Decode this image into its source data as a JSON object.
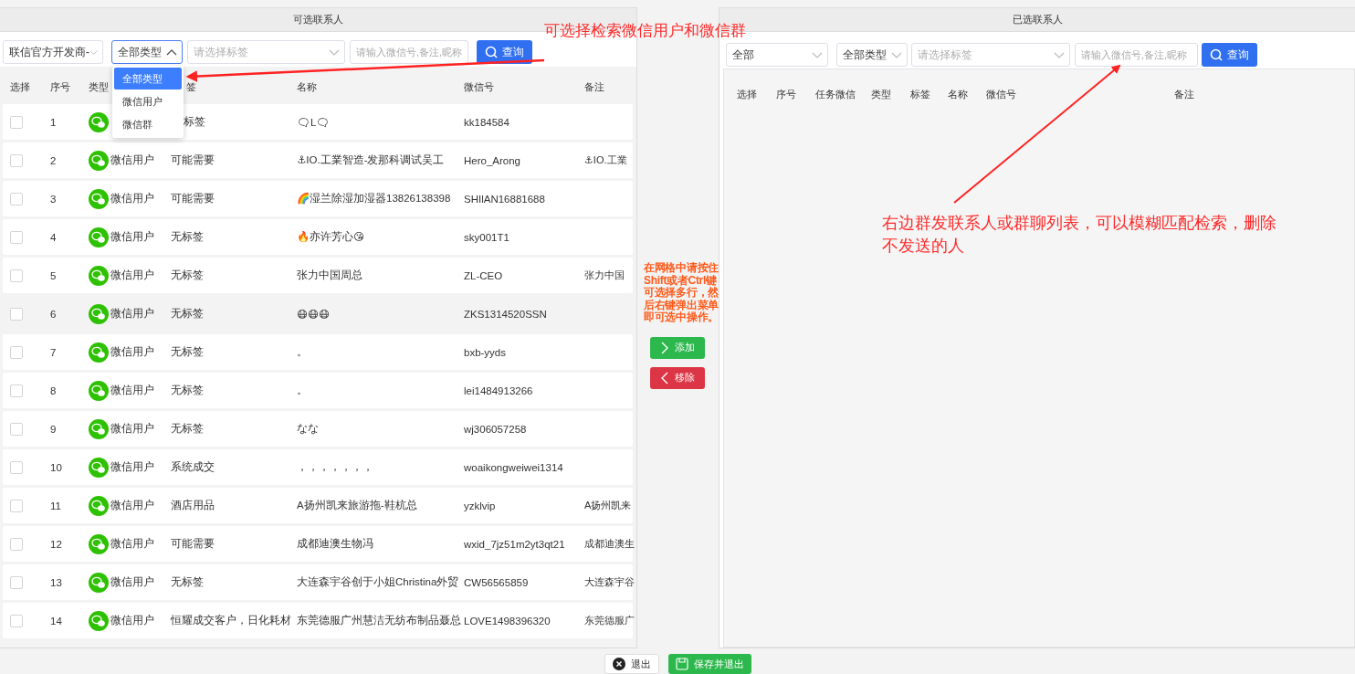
{
  "left_panel": {
    "title": "可选联系人",
    "filters": [
      {
        "kind": "select",
        "value": "联信官方开发商-",
        "open": false
      },
      {
        "kind": "select",
        "value": "全部类型",
        "open": true,
        "options": [
          {
            "label": "全部类型",
            "selected": true
          },
          {
            "label": "微信用户",
            "selected": false
          },
          {
            "label": "微信群",
            "selected": false
          }
        ]
      },
      {
        "kind": "select",
        "placeholder": "请选择标签",
        "open": false
      },
      {
        "kind": "input",
        "placeholder": "请输入微信号,备注,昵称"
      }
    ],
    "search_button": "查询",
    "columns": [
      "选择",
      "序号",
      "类型",
      "签",
      "名称",
      "微信号",
      "备注"
    ],
    "rows": [
      {
        "index": "1",
        "tag": "标签",
        "name": "🗨L🗨",
        "wechat_id": "kk184584",
        "checked": false,
        "highlighted": false
      },
      {
        "index": "2",
        "type": "微信用户",
        "tag": "可能需要",
        "name": "⚓IO.工業智造-发那科调试吴工",
        "wechat_id": "Hero_Arong",
        "remark": "⚓IO.工業",
        "checked": false,
        "highlighted": false
      },
      {
        "index": "3",
        "type": "微信用户",
        "tag": "可能需要",
        "name": "🌈湿兰除湿加湿器13826138398",
        "wechat_id": "SHIlAN16881688",
        "checked": false,
        "highlighted": false
      },
      {
        "index": "4",
        "type": "微信用户",
        "tag": "无标签",
        "name": "🔥亦许芳心😘",
        "wechat_id": "sky001T1",
        "checked": false,
        "highlighted": false
      },
      {
        "index": "5",
        "type": "微信用户",
        "tag": "无标签",
        "name": "张力中国周总",
        "wechat_id": "ZL-CEO",
        "remark": "张力中国",
        "checked": false,
        "highlighted": false
      },
      {
        "index": "6",
        "type": "微信用户",
        "tag": "无标签",
        "name": "😷😷😷",
        "wechat_id": "ZKS1314520SSN",
        "checked": false,
        "highlighted": true
      },
      {
        "index": "7",
        "type": "微信用户",
        "tag": "无标签",
        "name": "。",
        "wechat_id": "bxb-yyds",
        "checked": false,
        "highlighted": false
      },
      {
        "index": "8",
        "type": "微信用户",
        "tag": "无标签",
        "name": "。",
        "wechat_id": "lei1484913266",
        "checked": false,
        "highlighted": false
      },
      {
        "index": "9",
        "type": "微信用户",
        "tag": "无标签",
        "name": "なな",
        "wechat_id": "wj306057258",
        "checked": false,
        "highlighted": false
      },
      {
        "index": "10",
        "type": "微信用户",
        "tag": "系统成交",
        "name": "，，，，，，，",
        "wechat_id": "woaikongweiwei1314",
        "checked": false,
        "highlighted": false
      },
      {
        "index": "11",
        "type": "微信用户",
        "tag": "酒店用品",
        "name": "A扬州凯来旅游拖-鞋杭总",
        "wechat_id": "yzklvip",
        "remark": "A扬州凯来",
        "checked": false,
        "highlighted": false
      },
      {
        "index": "12",
        "type": "微信用户",
        "tag": "可能需要",
        "name": "成都迪澳生物冯",
        "wechat_id": "wxid_7jz51m2yt3qt21",
        "remark": "成都迪澳生",
        "checked": false,
        "highlighted": false
      },
      {
        "index": "13",
        "type": "微信用户",
        "tag": "无标签",
        "name": "大连森宇谷创于小姐Christina外贸",
        "wechat_id": "CW56565859",
        "remark": "大连森宇谷",
        "checked": false,
        "highlighted": false
      },
      {
        "index": "14",
        "type": "微信用户",
        "tag": "恒耀成交客户，日化耗材",
        "name": "东莞德服广州慧洁无纺布制品聂总",
        "wechat_id": "LOVE1498396320",
        "remark": "东莞德服广",
        "checked": false,
        "highlighted": false
      }
    ]
  },
  "middle": {
    "hint": "在网格中请按住Shift或者Ctrl键可选择多行，然后右键弹出菜单即可选中操作。",
    "add_button": "添加",
    "remove_button": "移除"
  },
  "right_panel": {
    "title": "已选联系人",
    "filters": [
      {
        "kind": "select",
        "value": "全部",
        "open": false
      },
      {
        "kind": "select",
        "value": "全部类型",
        "open": false
      },
      {
        "kind": "select",
        "placeholder": "请选择标签",
        "open": false
      },
      {
        "kind": "input",
        "placeholder": "请输入微信号,备注,昵称"
      }
    ],
    "search_button": "查询",
    "columns": [
      "选择",
      "序号",
      "任务微信",
      "类型",
      "标签",
      "名称",
      "微信号",
      "备注"
    ]
  },
  "annotations": [
    "可选择检索微信用户和微信群",
    "右边群发联系人或群聊列表，可以模糊匹配检索，删除不发送的人"
  ],
  "footer": {
    "exit_button": "退出",
    "save_button": "保存并退出"
  }
}
